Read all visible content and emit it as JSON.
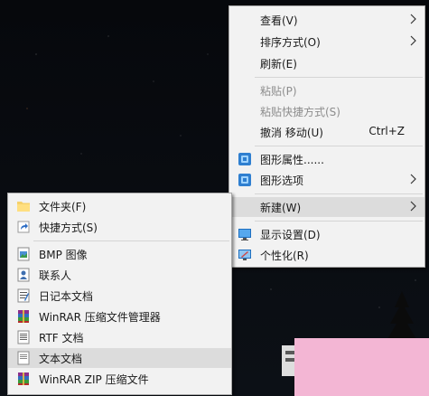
{
  "main_menu": {
    "items": [
      {
        "label": "查看(V)",
        "submenu": true
      },
      {
        "label": "排序方式(O)",
        "submenu": true
      },
      {
        "label": "刷新(E)"
      },
      {
        "label": "粘贴(P)",
        "disabled": true
      },
      {
        "label": "粘贴快捷方式(S)",
        "disabled": true
      },
      {
        "label": "撤消 移动(U)",
        "shortcut": "Ctrl+Z"
      },
      {
        "label": "图形属性......",
        "icon": "intel-graphics-icon"
      },
      {
        "label": "图形选项",
        "icon": "intel-graphics-icon",
        "submenu": true
      },
      {
        "label": "新建(W)",
        "submenu": true,
        "highlighted": true
      },
      {
        "label": "显示设置(D)",
        "icon": "display-settings-icon"
      },
      {
        "label": "个性化(R)",
        "icon": "personalize-icon"
      }
    ]
  },
  "new_submenu": {
    "items": [
      {
        "label": "文件夹(F)",
        "icon": "folder-icon"
      },
      {
        "label": "快捷方式(S)",
        "icon": "shortcut-icon"
      },
      {
        "label": "BMP 图像",
        "icon": "bmp-image-icon"
      },
      {
        "label": "联系人",
        "icon": "contact-icon"
      },
      {
        "label": "日记本文档",
        "icon": "journal-document-icon"
      },
      {
        "label": "WinRAR 压缩文件管理器",
        "icon": "winrar-icon"
      },
      {
        "label": "RTF 文档",
        "icon": "rtf-document-icon"
      },
      {
        "label": "文本文档",
        "icon": "text-document-icon",
        "highlighted": true
      },
      {
        "label": "WinRAR ZIP 压缩文件",
        "icon": "winrar-zip-icon"
      }
    ]
  },
  "colors": {
    "menu_bg": "#f2f2f2",
    "highlight": "#dcdcdc",
    "disabled_text": "#8d8d8d",
    "overlay": "#f3b6d4"
  }
}
